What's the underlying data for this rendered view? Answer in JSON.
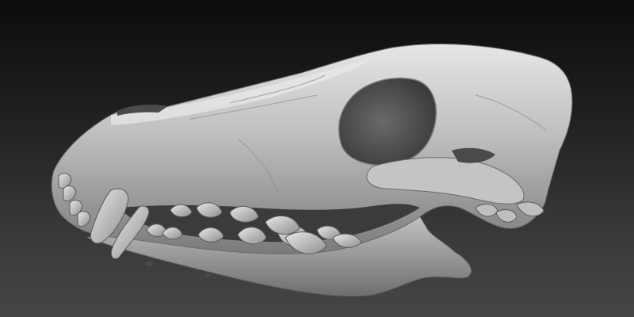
{
  "scene": {
    "subject": "sculpted-canine-skull-render",
    "colors": {
      "background_top": "#0c0c0c",
      "background_bottom": "#454545",
      "bone_light": "#d9d9d9",
      "bone_mid": "#a6a6a6",
      "bone_shadow": "#5a5a5a",
      "cavity": "#2a2a2a"
    }
  }
}
